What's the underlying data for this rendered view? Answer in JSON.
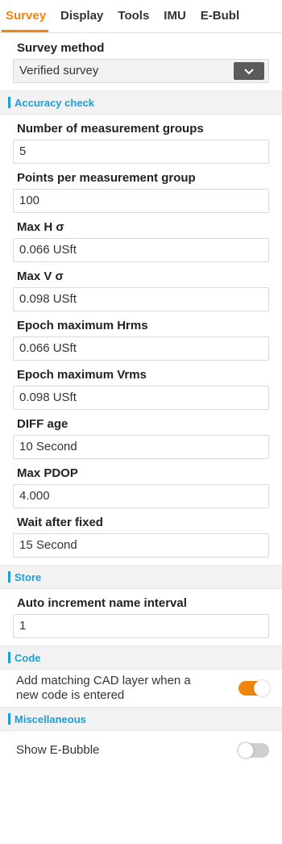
{
  "tabs": [
    "Survey",
    "Display",
    "Tools",
    "IMU",
    "E-Bubl"
  ],
  "survey_method": {
    "label": "Survey method",
    "value": "Verified survey"
  },
  "accuracy_check": {
    "title": "Accuracy check",
    "fields": [
      {
        "label": "Number of measurement groups",
        "value": "5"
      },
      {
        "label": "Points per measurement group",
        "value": "100"
      },
      {
        "label": "Max H σ",
        "value": "0.066 USft"
      },
      {
        "label": "Max V σ",
        "value": "0.098 USft"
      },
      {
        "label": "Epoch maximum Hrms",
        "value": "0.066 USft"
      },
      {
        "label": "Epoch maximum Vrms",
        "value": "0.098 USft"
      },
      {
        "label": "DIFF age",
        "value": "10 Second"
      },
      {
        "label": "Max PDOP",
        "value": "4.000"
      },
      {
        "label": "Wait after fixed",
        "value": "15 Second"
      }
    ]
  },
  "store": {
    "title": "Store",
    "auto_increment": {
      "label": "Auto increment name interval",
      "value": "1"
    }
  },
  "code": {
    "title": "Code",
    "cad_layer": {
      "line1": "Add matching CAD layer when a",
      "line2": "new code is entered",
      "enabled": true
    }
  },
  "misc": {
    "title": "Miscellaneous",
    "ebubble": {
      "label": "Show E-Bubble",
      "enabled": false
    }
  },
  "colors": {
    "accent": "#f0840d",
    "section": "#1a9fdc"
  }
}
